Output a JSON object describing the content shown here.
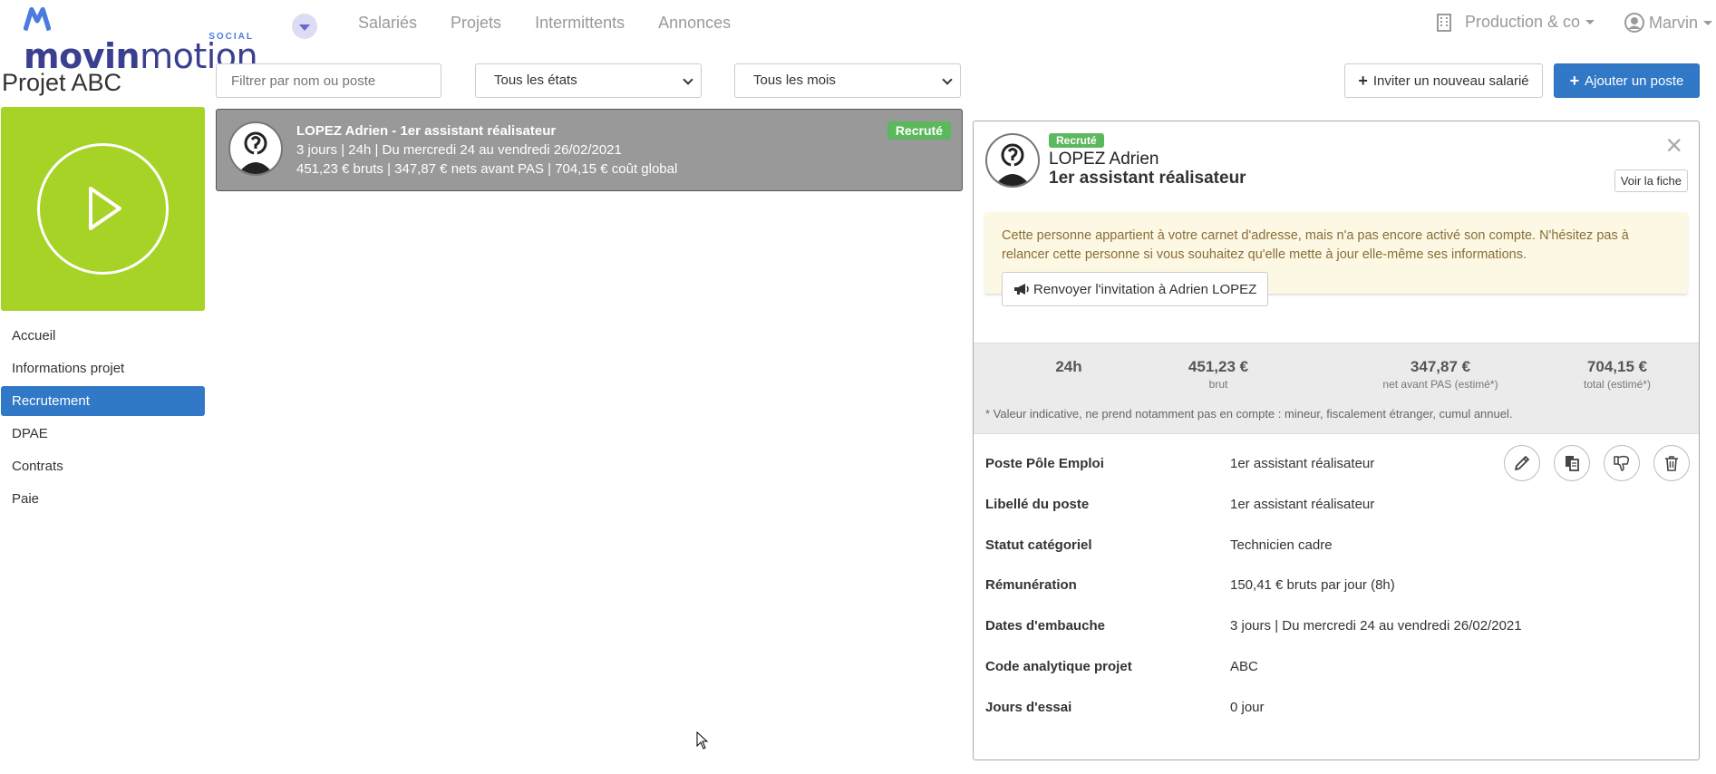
{
  "brand": {
    "logo_left": "movin",
    "logo_right": "motion",
    "logo_sub": "SOCIAL"
  },
  "nav": {
    "items": [
      "Salariés",
      "Projets",
      "Intermittents",
      "Annonces"
    ]
  },
  "company": {
    "name": "Production & co"
  },
  "user": {
    "name": "Marvin"
  },
  "project": {
    "title": "Projet ABC",
    "tile_color": "#a6d325"
  },
  "sidebar": {
    "items": [
      {
        "label": "Accueil"
      },
      {
        "label": "Informations projet"
      },
      {
        "label": "Recrutement"
      },
      {
        "label": "DPAE"
      },
      {
        "label": "Contrats"
      },
      {
        "label": "Paie"
      }
    ],
    "active": "Recrutement"
  },
  "filters": {
    "search_placeholder": "Filtrer par nom ou poste",
    "states_selected": "Tous les états",
    "months_selected": "Tous les mois"
  },
  "toolbar": {
    "invite_label": "Inviter un nouveau salarié",
    "add_post_label": "Ajouter un poste"
  },
  "employee_card": {
    "title": "LOPEZ Adrien - 1er assistant réalisateur",
    "schedule": "3 jours | 24h | Du mercredi 24 au vendredi 26/02/2021",
    "pay": "451,23 € bruts | 347,87 € nets avant PAS | 704,15 € coût global",
    "status": "Recruté"
  },
  "detail": {
    "status": "Recruté",
    "name": "LOPEZ Adrien",
    "role": "1er assistant réalisateur",
    "close_icon": "×",
    "voir_fiche_label": "Voir la fiche",
    "alert_text": "Cette personne appartient à votre carnet d'adresse, mais n'a pas encore activé son compte. N'hésitez pas à relancer cette personne si vous souhaitez qu'elle mette à jour elle-même ses informations.",
    "resend_label": "Renvoyer l'invitation à Adrien LOPEZ",
    "stats": [
      {
        "value": "24h",
        "label": ""
      },
      {
        "value": "451,23 €",
        "label": "brut"
      },
      {
        "value": "347,87 €",
        "label": "net avant PAS (estimé*)"
      },
      {
        "value": "704,15 €",
        "label": "total (estimé*)"
      }
    ],
    "stats_note": "* Valeur indicative, ne prend notamment pas en compte : mineur, fiscalement étranger, cumul annuel.",
    "rows": [
      {
        "label": "Poste Pôle Emploi",
        "value": "1er assistant réalisateur"
      },
      {
        "label": "Libellé du poste",
        "value": "1er assistant réalisateur"
      },
      {
        "label": "Statut catégoriel",
        "value": "Technicien cadre"
      },
      {
        "label": "Rémunération",
        "value": "150,41 € bruts par jour (8h)"
      },
      {
        "label": "Dates d'embauche",
        "value": "3 jours | Du mercredi 24 au vendredi 26/02/2021"
      },
      {
        "label": "Code analytique projet",
        "value": "ABC"
      },
      {
        "label": "Jours d'essai",
        "value": "0 jour"
      }
    ],
    "actions": [
      "pencil-icon",
      "copy-icon",
      "thumbs-down-icon",
      "trash-icon"
    ]
  },
  "colors": {
    "primary": "#3178c6",
    "success": "#5cb85c",
    "warning_bg": "#fcf8e3",
    "warning_text": "#8a6d3b"
  }
}
